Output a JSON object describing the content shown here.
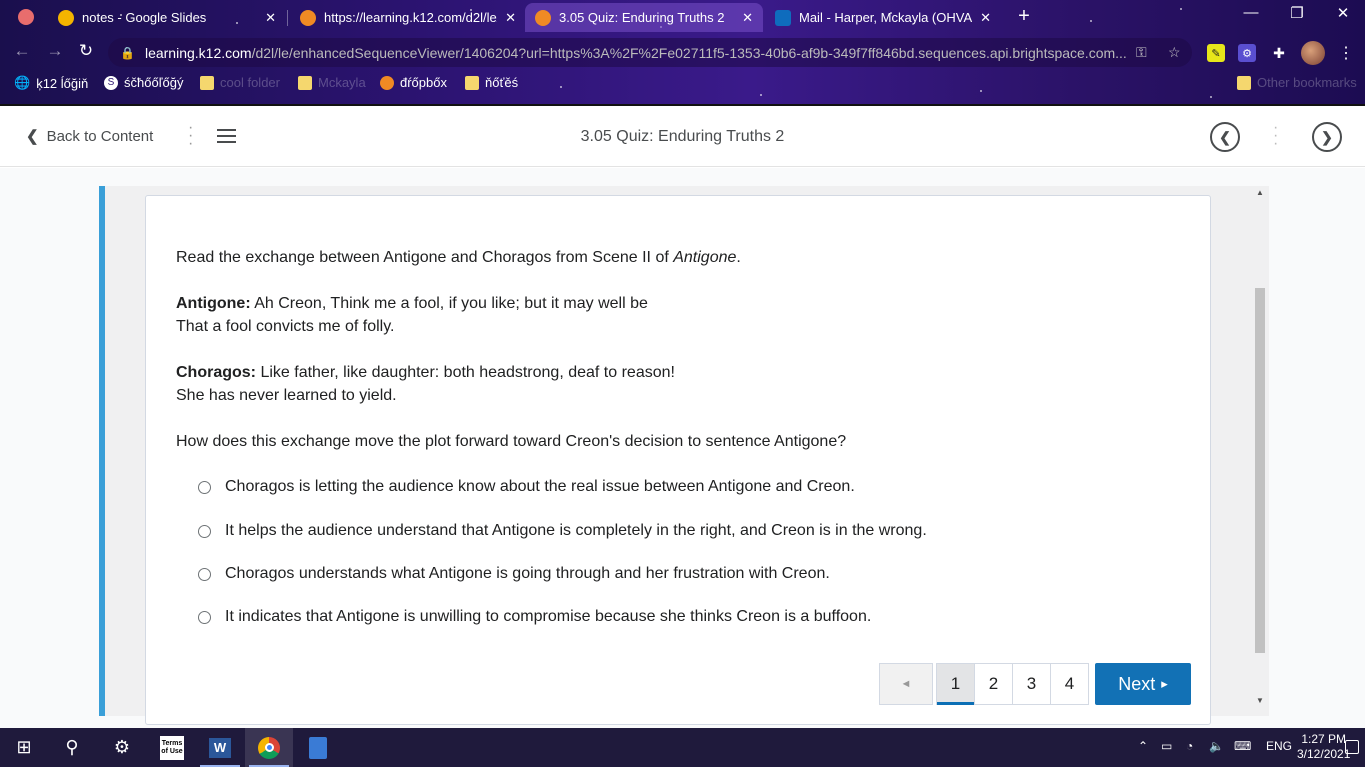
{
  "browser": {
    "tabs": [
      {
        "title": "notes - Google Slides",
        "favicon_color": "#f4b400"
      },
      {
        "title": "https://learning.k12.com/d2l/le/e",
        "favicon_color": "#f08a24"
      },
      {
        "title": "3.05 Quiz: Enduring Truths 2",
        "favicon_color": "#f08a24"
      },
      {
        "title": "Mail - Harper, Mckayla (OHVA St",
        "favicon_color": "#0f6cbd"
      }
    ],
    "tab_close": "✕",
    "new_tab": "+",
    "window_controls": {
      "minimize": "—",
      "restore": "❐",
      "close": "✕"
    },
    "url_host": "learning.k12.com",
    "url_path": "/d2l/le/enhancedSequenceViewer/1406204?url=https%3A%2F%2Fe02711f5-1353-40b6-af9b-349f7ff846bd.sequences.api.brightspace.com...",
    "bookmarks": [
      {
        "label": "ķ12 ĺőğiň",
        "icon": "globe-icon",
        "faded": false
      },
      {
        "label": "śčħőőľőğý",
        "icon": "schoology-icon",
        "faded": false
      },
      {
        "label": "cool folder",
        "icon": "folder-icon",
        "faded": true
      },
      {
        "label": "Mckayla",
        "icon": "folder-icon",
        "faded": true
      },
      {
        "label": "đŕőpbőx",
        "icon": "dropbox-icon",
        "faded": false
      },
      {
        "label": "ňőťěś",
        "icon": "folder-icon",
        "faded": false
      }
    ],
    "other_bookmarks": "Other bookmarks"
  },
  "header": {
    "back_label": "Back to Content",
    "title": "3.05 Quiz: Enduring Truths 2"
  },
  "quiz": {
    "intro_prefix": "Read the exchange between Antigone and Choragos from Scene II of ",
    "intro_title": "Antigone",
    "intro_suffix": ".",
    "speaker1": "Antigone:",
    "line1a": " Ah Creon, Think me a fool, if you like; but it may well be",
    "line1b": "That a fool convicts me of folly.",
    "speaker2": "Choragos:",
    "line2a": " Like father, like daughter: both headstrong, deaf to reason!",
    "line2b": "She has never learned to yield.",
    "question": "How does this exchange move the plot forward toward Creon's decision to sentence Antigone?",
    "options": [
      "Choragos is letting the audience know about the real issue between Antigone and Creon.",
      "It helps the audience understand that Antigone is completely in the right, and Creon is in the wrong.",
      "Choragos understands what Antigone is going through and her frustration with Creon.",
      "It indicates that Antigone is unwilling to compromise because she thinks Creon is a buffoon."
    ],
    "selected_option": null
  },
  "pager": {
    "prev": "◄",
    "pages": [
      "1",
      "2",
      "3",
      "4"
    ],
    "current_page": "1",
    "next_label": "Next",
    "next_arrow": "▸"
  },
  "taskbar": {
    "start": "⊞",
    "search": "⚲",
    "settings": "⚙",
    "terms_label": "Terms of Use",
    "word": "W",
    "language": "ENG",
    "time": "1:27 PM",
    "date": "3/12/2021"
  }
}
